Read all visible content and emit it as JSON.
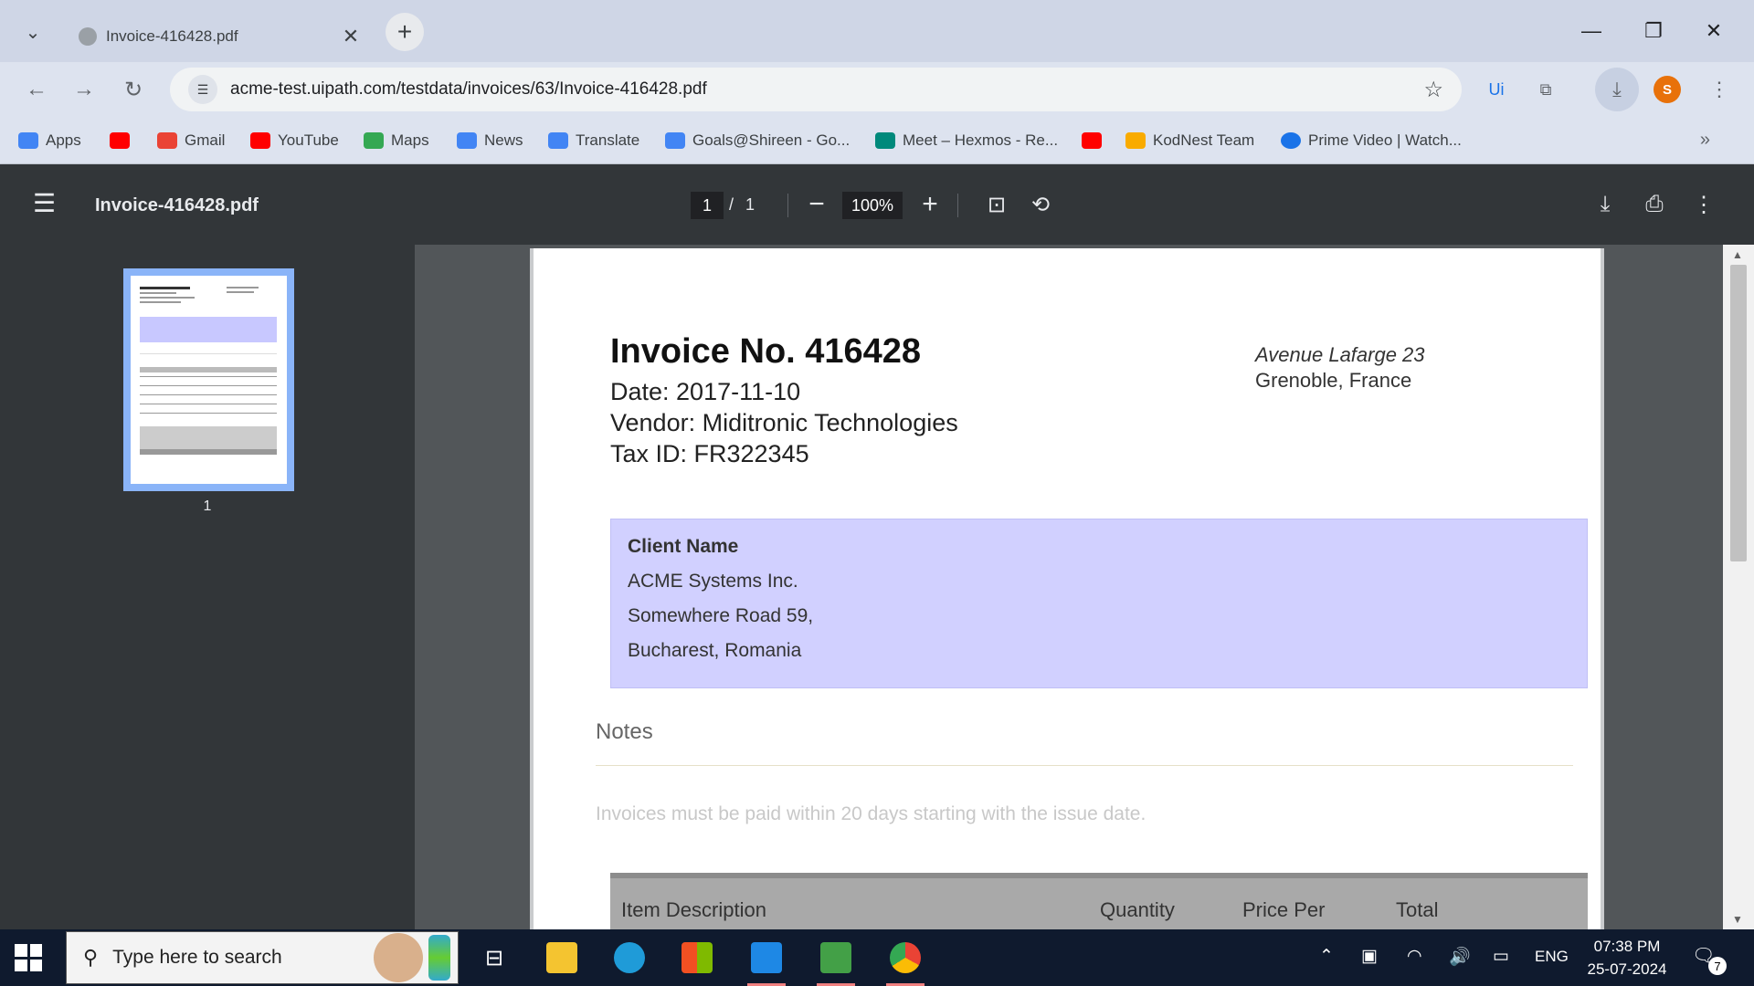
{
  "browser": {
    "tab": {
      "title": "Invoice-416428.pdf"
    },
    "address": {
      "url": "acme-test.uipath.com/testdata/invoices/63/Invoice-416428.pdf"
    },
    "bookmarks": [
      {
        "label": "Apps",
        "color": "#4285f4"
      },
      {
        "label": "",
        "color": "#ff0000"
      },
      {
        "label": "Gmail",
        "color": "#ea4335"
      },
      {
        "label": "YouTube",
        "color": "#ff0000"
      },
      {
        "label": "Maps",
        "color": "#34a853"
      },
      {
        "label": "News",
        "color": "#4285f4"
      },
      {
        "label": "Translate",
        "color": "#4285f4"
      },
      {
        "label": "Goals@Shireen - Go...",
        "color": "#4285f4"
      },
      {
        "label": "Meet – Hexmos - Re...",
        "color": "#00897b"
      },
      {
        "label": "",
        "color": "#ff0000"
      },
      {
        "label": "KodNest Team",
        "color": "#f9ab00"
      },
      {
        "label": "Prime Video | Watch...",
        "color": "#1a73e8"
      }
    ],
    "more_bookmarks": "»"
  },
  "pdf_viewer": {
    "title": "Invoice-416428.pdf",
    "current_page": "1",
    "separator": "/",
    "total_pages": "1",
    "zoom": "100%",
    "thumbnail_label": "1"
  },
  "invoice": {
    "title": "Invoice No. 416428",
    "date": "Date: 2017-11-10",
    "vendor": "Vendor: Miditronic Technologies",
    "tax_id": "Tax ID: FR322345",
    "address_line1": "Avenue Lafarge 23",
    "address_line2": "Grenoble, France",
    "client": {
      "heading": "Client Name",
      "name": "ACME Systems Inc.",
      "street": "Somewhere Road 59,",
      "city": "Bucharest, Romania"
    },
    "notes_heading": "Notes",
    "notes_text": "Invoices must be paid within 20 days starting with the issue date.",
    "table_headers": {
      "description": "Item Description",
      "quantity": "Quantity",
      "price": "Price Per",
      "total": "Total"
    }
  },
  "taskbar": {
    "search_placeholder": "Type here to search",
    "language": "ENG",
    "time": "07:38 PM",
    "date": "25-07-2024",
    "notification_count": "7"
  }
}
